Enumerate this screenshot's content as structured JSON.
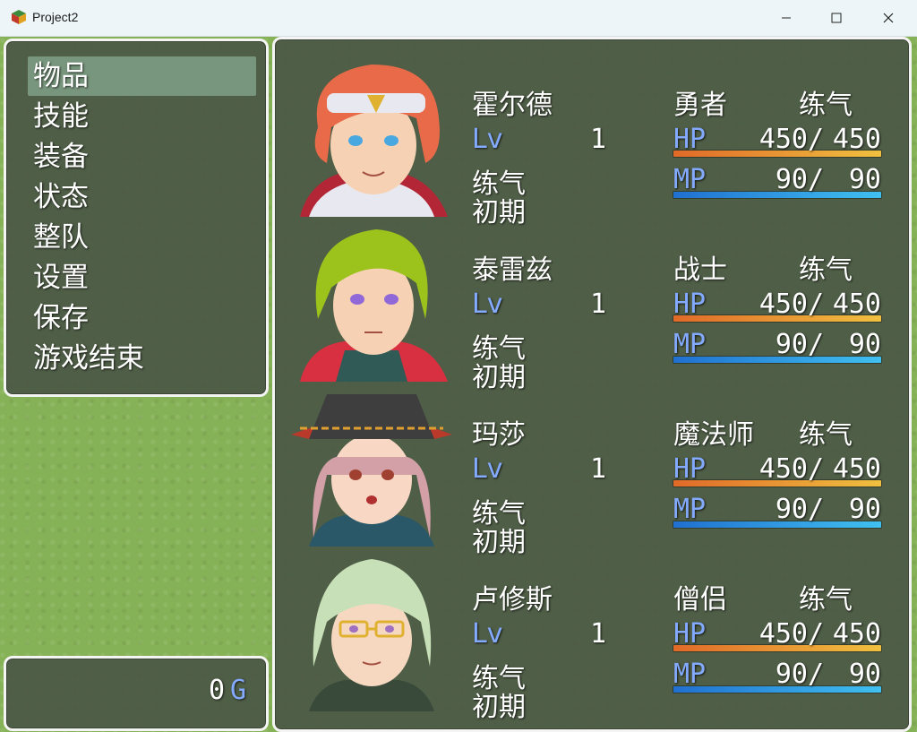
{
  "window": {
    "title": "Project2"
  },
  "menu": {
    "items": [
      {
        "label": "物品",
        "selected": true
      },
      {
        "label": "技能",
        "selected": false
      },
      {
        "label": "装备",
        "selected": false
      },
      {
        "label": "状态",
        "selected": false
      },
      {
        "label": "整队",
        "selected": false
      },
      {
        "label": "设置",
        "selected": false
      },
      {
        "label": "保存",
        "selected": false
      },
      {
        "label": "游戏结束",
        "selected": false
      }
    ]
  },
  "gold": {
    "value": "0",
    "unit": "G"
  },
  "party": [
    {
      "name": "霍尔德",
      "class": "勇者",
      "nickname": "练气",
      "lv_label": "Lv",
      "level": "1",
      "state_line1": "练气",
      "state_line2": "初期",
      "hp_label": "HP",
      "hp": "450",
      "hp_max": "450",
      "hp_fraction": 1.0,
      "mp_label": "MP",
      "mp": "90",
      "mp_max": "90",
      "mp_fraction": 1.0,
      "portrait": "hero-portrait-red-hair"
    },
    {
      "name": "泰雷兹",
      "class": "战士",
      "nickname": "练气",
      "lv_label": "Lv",
      "level": "1",
      "state_line1": "练气",
      "state_line2": "初期",
      "hp_label": "HP",
      "hp": "450",
      "hp_max": "450",
      "hp_fraction": 1.0,
      "mp_label": "MP",
      "mp": "90",
      "mp_max": "90",
      "mp_fraction": 1.0,
      "portrait": "warrior-portrait-green-hair"
    },
    {
      "name": "玛莎",
      "class": "魔法师",
      "nickname": "练气",
      "lv_label": "Lv",
      "level": "1",
      "state_line1": "练气",
      "state_line2": "初期",
      "hp_label": "HP",
      "hp": "450",
      "hp_max": "450",
      "hp_fraction": 1.0,
      "mp_label": "MP",
      "mp": "90",
      "mp_max": "90",
      "mp_fraction": 1.0,
      "portrait": "mage-portrait-witch-hat"
    },
    {
      "name": "卢修斯",
      "class": "僧侣",
      "nickname": "练气",
      "lv_label": "Lv",
      "level": "1",
      "state_line1": "练气",
      "state_line2": "初期",
      "hp_label": "HP",
      "hp": "450",
      "hp_max": "450",
      "hp_fraction": 1.0,
      "mp_label": "MP",
      "mp": "90",
      "mp_max": "90",
      "mp_fraction": 1.0,
      "portrait": "priest-portrait-glasses"
    }
  ],
  "colors": {
    "system_text": "#84aaff",
    "window_bg": "#4b5746",
    "hp_gauge": [
      "#e06a28",
      "#f0c040"
    ],
    "mp_gauge": [
      "#2070d0",
      "#40c0f0"
    ]
  }
}
